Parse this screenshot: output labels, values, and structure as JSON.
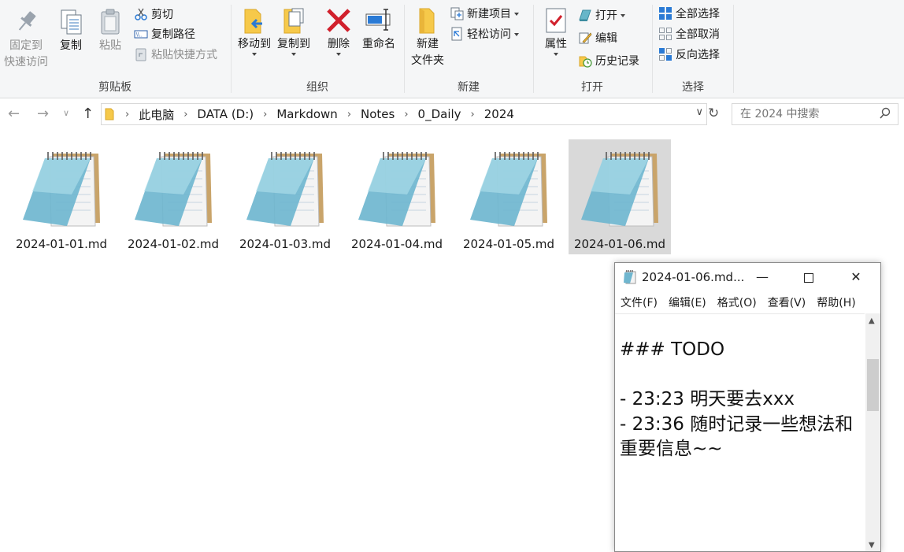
{
  "ribbon": {
    "groups": {
      "clipboard": "剪贴板",
      "organize": "组织",
      "new": "新建",
      "open": "打开",
      "select": "选择"
    },
    "pin_line1": "固定到",
    "pin_line2": "快速访问",
    "copy": "复制",
    "paste": "粘贴",
    "cut": "剪切",
    "copy_path": "复制路径",
    "paste_shortcut": "粘贴快捷方式",
    "move_to": "移动到",
    "copy_to": "复制到",
    "delete": "删除",
    "rename": "重命名",
    "new_folder_line1": "新建",
    "new_folder_line2": "文件夹",
    "new_item": "新建项目",
    "easy_access": "轻松访问",
    "properties": "属性",
    "open": "打开",
    "edit": "编辑",
    "history": "历史记录",
    "select_all": "全部选择",
    "select_none": "全部取消",
    "invert_selection": "反向选择"
  },
  "address": {
    "crumbs": [
      "此电脑",
      "DATA (D:)",
      "Markdown",
      "Notes",
      "0_Daily",
      "2024"
    ],
    "search_placeholder": "在 2024 中搜索"
  },
  "files": [
    {
      "name": "2024-01-01.md",
      "selected": false
    },
    {
      "name": "2024-01-02.md",
      "selected": false
    },
    {
      "name": "2024-01-03.md",
      "selected": false
    },
    {
      "name": "2024-01-04.md",
      "selected": false
    },
    {
      "name": "2024-01-05.md",
      "selected": false
    },
    {
      "name": "2024-01-06.md",
      "selected": true
    }
  ],
  "notepad": {
    "title": "2024-01-06.md...",
    "menu": [
      "文件(F)",
      "编辑(E)",
      "格式(O)",
      "查看(V)",
      "帮助(H)"
    ],
    "content": "### TODO\n\n- 23:23 明天要去xxx\n- 23:36 随时记录一些想法和重要信息~~"
  },
  "colors": {
    "ribbon_bg": "#f5f6f7",
    "selected_item_bg": "#d9d9d9",
    "delete_red": "#d1202c",
    "folder_yellow": "#f6c94a",
    "accent_blue": "#2a7ad5"
  }
}
